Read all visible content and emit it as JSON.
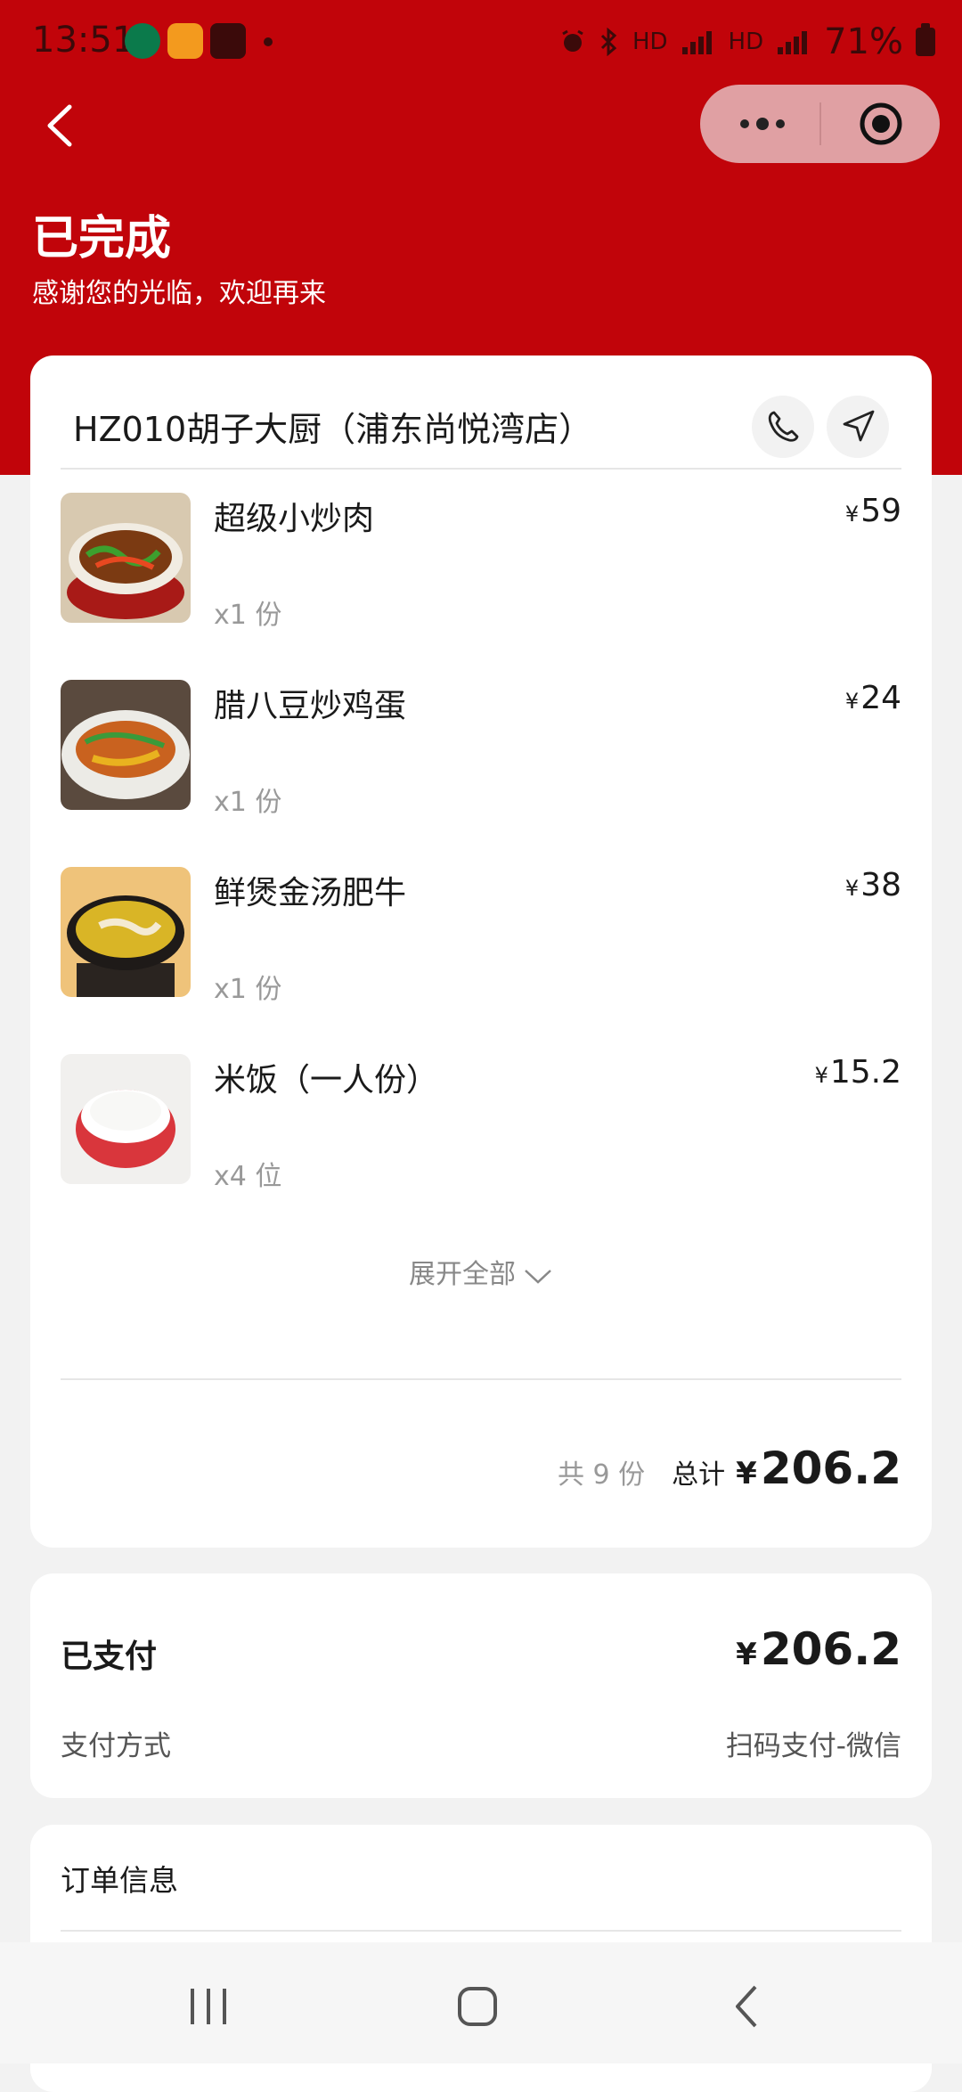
{
  "status_bar": {
    "time": "13:51",
    "battery": "71%",
    "network_1": "HD",
    "network_2": "HD"
  },
  "colors": {
    "primary_red": "#c1040a",
    "card_bg": "#ffffff",
    "page_bg": "#f2f2f2"
  },
  "header": {
    "title": "已完成",
    "subtitle": "感谢您的光临，欢迎再来"
  },
  "order": {
    "store_name": "HZ010胡子大厨（浦东尚悦湾店）",
    "currency": "¥",
    "items": [
      {
        "name": "超级小炒肉",
        "qty": "x1 份",
        "price": "59"
      },
      {
        "name": "腊八豆炒鸡蛋",
        "qty": "x1 份",
        "price": "24"
      },
      {
        "name": "鲜煲金汤肥牛",
        "qty": "x1 份",
        "price": "38"
      },
      {
        "name": "米饭（一人份）",
        "qty": "x4 位",
        "price": "15.2"
      }
    ],
    "expand_label": "展开全部",
    "total_count": "共 9 份",
    "total_label": "总计",
    "total_amount": "206.2"
  },
  "payment": {
    "label": "已支付",
    "currency": "¥",
    "amount": "206.2",
    "method_label": "支付方式",
    "method_value": "扫码支付-微信"
  },
  "order_info": {
    "label": "订单信息"
  }
}
